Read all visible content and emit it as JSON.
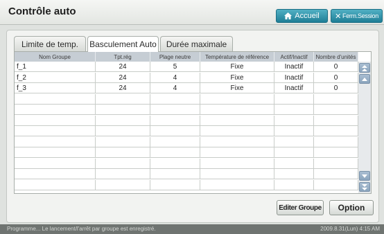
{
  "header": {
    "title": "Contrôle auto",
    "home_label": "Accueil",
    "logout_label": "Ferm.Session"
  },
  "tabs": [
    {
      "label": "Limite de temp.",
      "active": false
    },
    {
      "label": "Basculement Auto",
      "active": true
    },
    {
      "label": "Durée maximale",
      "active": false
    }
  ],
  "table": {
    "columns": [
      "Nom Groupe",
      "Tpt.rég",
      "Plage neutre",
      "Température de référence",
      "Actif/Inactif",
      "Nombre d'unités"
    ],
    "rows": [
      [
        "f_1",
        "24",
        "5",
        "Fixe",
        "Inactif",
        "0"
      ],
      [
        "f_2",
        "24",
        "4",
        "Fixe",
        "Inactif",
        "0"
      ],
      [
        "f_3",
        "24",
        "4",
        "Fixe",
        "Inactif",
        "0"
      ],
      [
        "",
        "",
        "",
        "",
        "",
        ""
      ],
      [
        "",
        "",
        "",
        "",
        "",
        ""
      ],
      [
        "",
        "",
        "",
        "",
        "",
        ""
      ],
      [
        "",
        "",
        "",
        "",
        "",
        ""
      ],
      [
        "",
        "",
        "",
        "",
        "",
        ""
      ],
      [
        "",
        "",
        "",
        "",
        "",
        ""
      ],
      [
        "",
        "",
        "",
        "",
        "",
        ""
      ],
      [
        "",
        "",
        "",
        "",
        "",
        ""
      ],
      [
        "",
        "",
        "",
        "",
        "",
        ""
      ]
    ]
  },
  "buttons": {
    "edit_group": "Editer Groupe",
    "option": "Option"
  },
  "status": {
    "message": "Programme... Le lancement/l'arrêt par groupe est enregistré.",
    "datetime": "2009.8.31(Lun) 4:15 AM"
  },
  "colors": {
    "accent": "#2a8ba3",
    "header_row": "#c6cdd4",
    "status_bar": "#6f7471"
  }
}
